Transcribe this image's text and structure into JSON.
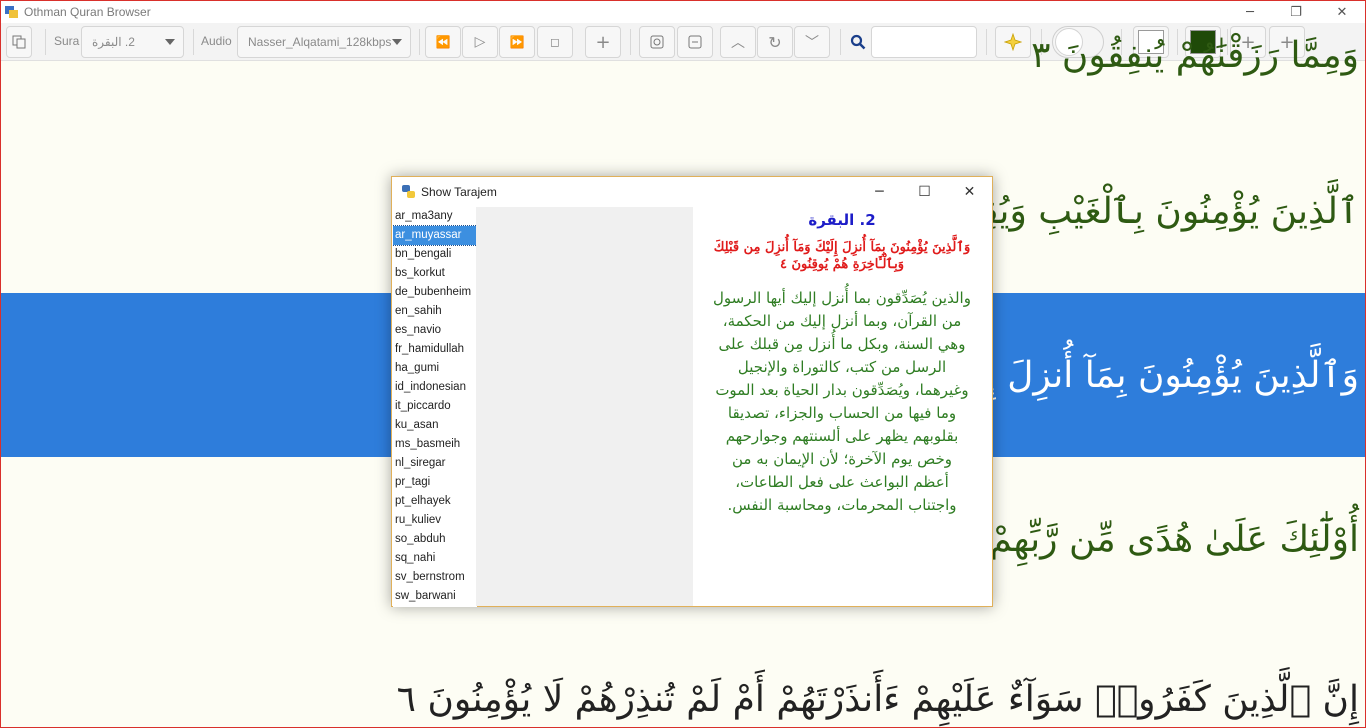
{
  "window": {
    "title": "Othman Quran Browser",
    "controls": {
      "minimize": "─",
      "restore": "❐",
      "close": "✕"
    }
  },
  "toolbar": {
    "sura_label": "Sura",
    "sura_value": "2. البقرة",
    "audio_label": "Audio",
    "audio_value": "Nasser_Alqatami_128kbps",
    "buttons": {
      "rewind": "⏪",
      "play": "▷",
      "forward": "⏩",
      "stop": "◻",
      "add": "+",
      "up": "︿",
      "repeat": "↻",
      "down": "﹀",
      "zoom_in": "+",
      "zoom_in_2": "+"
    },
    "search_value": "",
    "colors": {
      "background_swatch": "#ffffff",
      "text_swatch": "#1f4a08"
    }
  },
  "content": {
    "verses": [
      "وَمِمَّا رَزَقْنَٰهُمْ يُنفِقُونَ ٣",
      "ٱلَّذِينَ يُؤْمِنُونَ بِٱلْغَيْبِ وَيُقِيمُونَ",
      "وَٱلَّذِينَ يُؤْمِنُونَ بِمَآ أُنزِلَ إِلَيْكَ وَ",
      "أُوْلَٰٓئِكَ عَلَىٰ هُدًى مِّن رَّبِّهِمْ وَأُو",
      "إِنَّ ٱلَّذِينَ كَفَرُوا۟ سَوَآءٌ عَلَيْهِمْ ءَأَنذَرْتَهُمْ أَمْ لَمْ تُنذِرْهُمْ لَا يُؤْمِنُونَ ٦"
    ]
  },
  "dialog": {
    "title": "Show Tarajem",
    "controls": {
      "minimize": "─",
      "maximize": "☐",
      "close": "✕"
    },
    "languages": [
      "ar_ma3any",
      "ar_muyassar",
      "bn_bengali",
      "bs_korkut",
      "de_bubenheim",
      "en_sahih",
      "es_navio",
      "fr_hamidullah",
      "ha_gumi",
      "id_indonesian",
      "it_piccardo",
      "ku_asan",
      "ms_basmeih",
      "nl_siregar",
      "pr_tagi",
      "pt_elhayek",
      "ru_kuliev",
      "so_abduh",
      "sq_nahi",
      "sv_bernstrom",
      "sw_barwani"
    ],
    "selected_language": "ar_muyassar",
    "sura_heading": "2. البقرة",
    "ayah_text": "وَٱلَّذِينَ يُؤْمِنُونَ بِمَآ أُنزِلَ إِلَيْكَ وَمَآ أُنزِلَ مِن قَبْلِكَ وَبِٱلْـَٔاخِرَةِ هُمْ يُوقِنُونَ ٤",
    "translation": "والذين يُصَدِّقون بما أُنزل إليك أيها الرسول من القرآن، وبما أنزل إليك من الحكمة، وهي السنة، وبكل ما أُنزل مِن قبلك على الرسل من كتب، كالتوراة والإنجيل وغيرهما، ويُصَدِّقون بدار الحياة بعد الموت وما فيها من الحساب والجزاء، تصديقا بقلوبهم يظهر على ألسنتهم وجوارحهم وخص يوم الآخرة؛ لأن الإيمان به من أعظم البواعث على فعل الطاعات، واجتناب المحرمات، ومحاسبة النفس."
  }
}
